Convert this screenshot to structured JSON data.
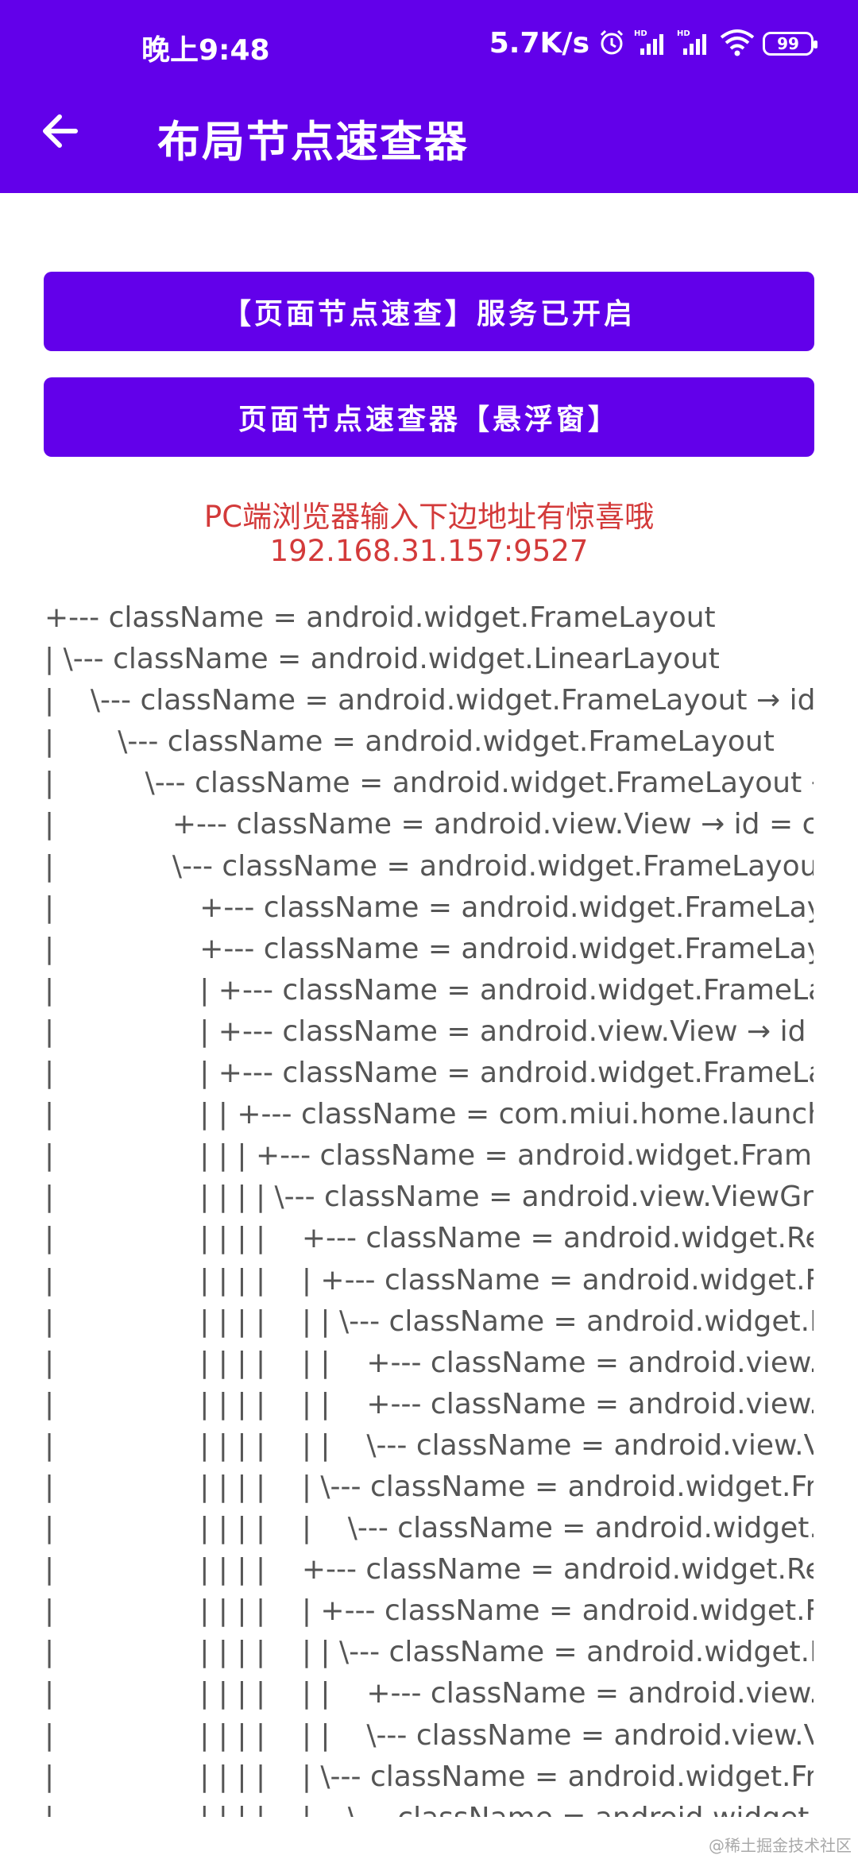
{
  "status_bar": {
    "time": "晚上9:48",
    "speed": "5.7K/s",
    "battery": "99"
  },
  "header": {
    "title": "布局节点速查器"
  },
  "buttons": {
    "service_status": "【页面节点速查】服务已开启",
    "floating_window": "页面节点速查器【悬浮窗】"
  },
  "notice": {
    "line1": "PC端浏览器输入下边地址有惊喜哦",
    "line2": "192.168.31.157:9527"
  },
  "tree_lines": [
    "+--- className = android.widget.FrameLayout",
    "| \\--- className = android.widget.LinearLayout",
    "|    \\--- className = android.widget.FrameLayout → id",
    "|       \\--- className = android.widget.FrameLayout",
    "|          \\--- className = android.widget.FrameLayout →",
    "|             +--- className = android.view.View → id = com",
    "|             \\--- className = android.widget.FrameLayout →",
    "|                +--- className = android.widget.FrameLayout",
    "|                +--- className = android.widget.FrameLayout",
    "|                | +--- className = android.widget.FrameLayo",
    "|                | +--- className = android.view.View → id = c",
    "|                | +--- className = android.widget.FrameLayo",
    "|                | | +--- className = com.miui.home.launcher.",
    "|                | | | +--- className = android.widget.FrameL",
    "|                | | | | \\--- className = android.view.ViewGro",
    "|                | | | |    +--- className = android.widget.Relat",
    "|                | | | |    | +--- className = android.widget.Fra",
    "|                | | | |    | | \\--- className = android.widget.Fr",
    "|                | | | |    | |    +--- className = android.view.Vi",
    "|                | | | |    | |    +--- className = android.view.Vi",
    "|                | | | |    | |    \\--- className = android.view.Vie",
    "|                | | | |    | \\--- className = android.widget.Fran",
    "|                | | | |    |    \\--- className = android.widget.Te",
    "|                | | | |    +--- className = android.widget.Relat",
    "|                | | | |    | +--- className = android.widget.Fra",
    "|                | | | |    | | \\--- className = android.widget.Fr",
    "|                | | | |    | |    +--- className = android.view.Vi",
    "|                | | | |    | |    \\--- className = android.view.Vie",
    "|                | | | |    | \\--- className = android.widget.Fran",
    "|                | | | |    |    \\--- className = android.widget.Te"
  ],
  "watermark": "@稀土掘金技术社区",
  "colors": {
    "primary": "#6200ea",
    "notice_text": "#d33a3a",
    "tree_text": "#555555"
  }
}
